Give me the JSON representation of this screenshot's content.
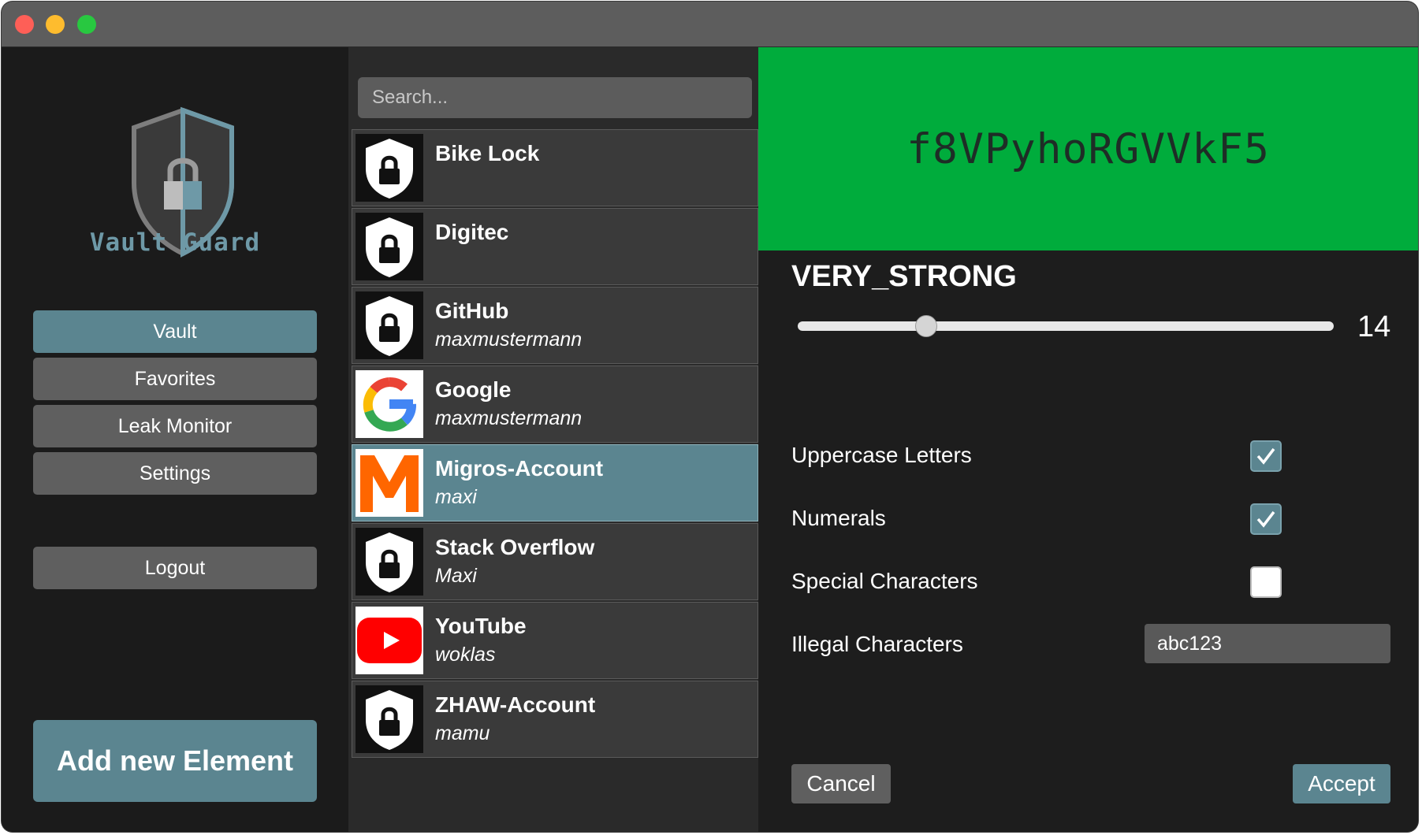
{
  "app": {
    "logo_text": "Vault Guard"
  },
  "sidebar": {
    "nav": [
      {
        "label": "Vault",
        "active": true
      },
      {
        "label": "Favorites",
        "active": false
      },
      {
        "label": "Leak Monitor",
        "active": false
      },
      {
        "label": "Settings",
        "active": false
      }
    ],
    "logout_label": "Logout",
    "add_label": "Add new Element"
  },
  "search": {
    "placeholder": "Search..."
  },
  "entries": [
    {
      "title": "Bike Lock",
      "user": "",
      "icon": "lock-icon"
    },
    {
      "title": "Digitec",
      "user": "",
      "icon": "lock-icon"
    },
    {
      "title": "GitHub",
      "user": "maxmustermann",
      "icon": "lock-icon"
    },
    {
      "title": "Google",
      "user": "maxmustermann",
      "icon": "google-logo-icon"
    },
    {
      "title": "Migros-Account",
      "user": "maxi",
      "icon": "migros-logo-icon",
      "selected": true
    },
    {
      "title": "Stack Overflow",
      "user": "Maxi",
      "icon": "lock-icon"
    },
    {
      "title": "YouTube",
      "user": "woklas",
      "icon": "youtube-logo-icon"
    },
    {
      "title": "ZHAW-Account",
      "user": "mamu",
      "icon": "lock-icon"
    }
  ],
  "generator": {
    "password": "f8VPyhoRGVVkF5",
    "strength": "VERY_STRONG",
    "length": "14",
    "length_fraction": 0.24,
    "options": [
      {
        "label": "Uppercase Letters",
        "checked": true
      },
      {
        "label": "Numerals",
        "checked": true
      },
      {
        "label": "Special Characters",
        "checked": false
      }
    ],
    "illegal_label": "Illegal Characters",
    "illegal_value": "abc123",
    "cancel_label": "Cancel",
    "accept_label": "Accept"
  },
  "colors": {
    "accent": "#5b8590",
    "strength_green": "#00ac3c",
    "button_gray": "#5f5f5f"
  }
}
